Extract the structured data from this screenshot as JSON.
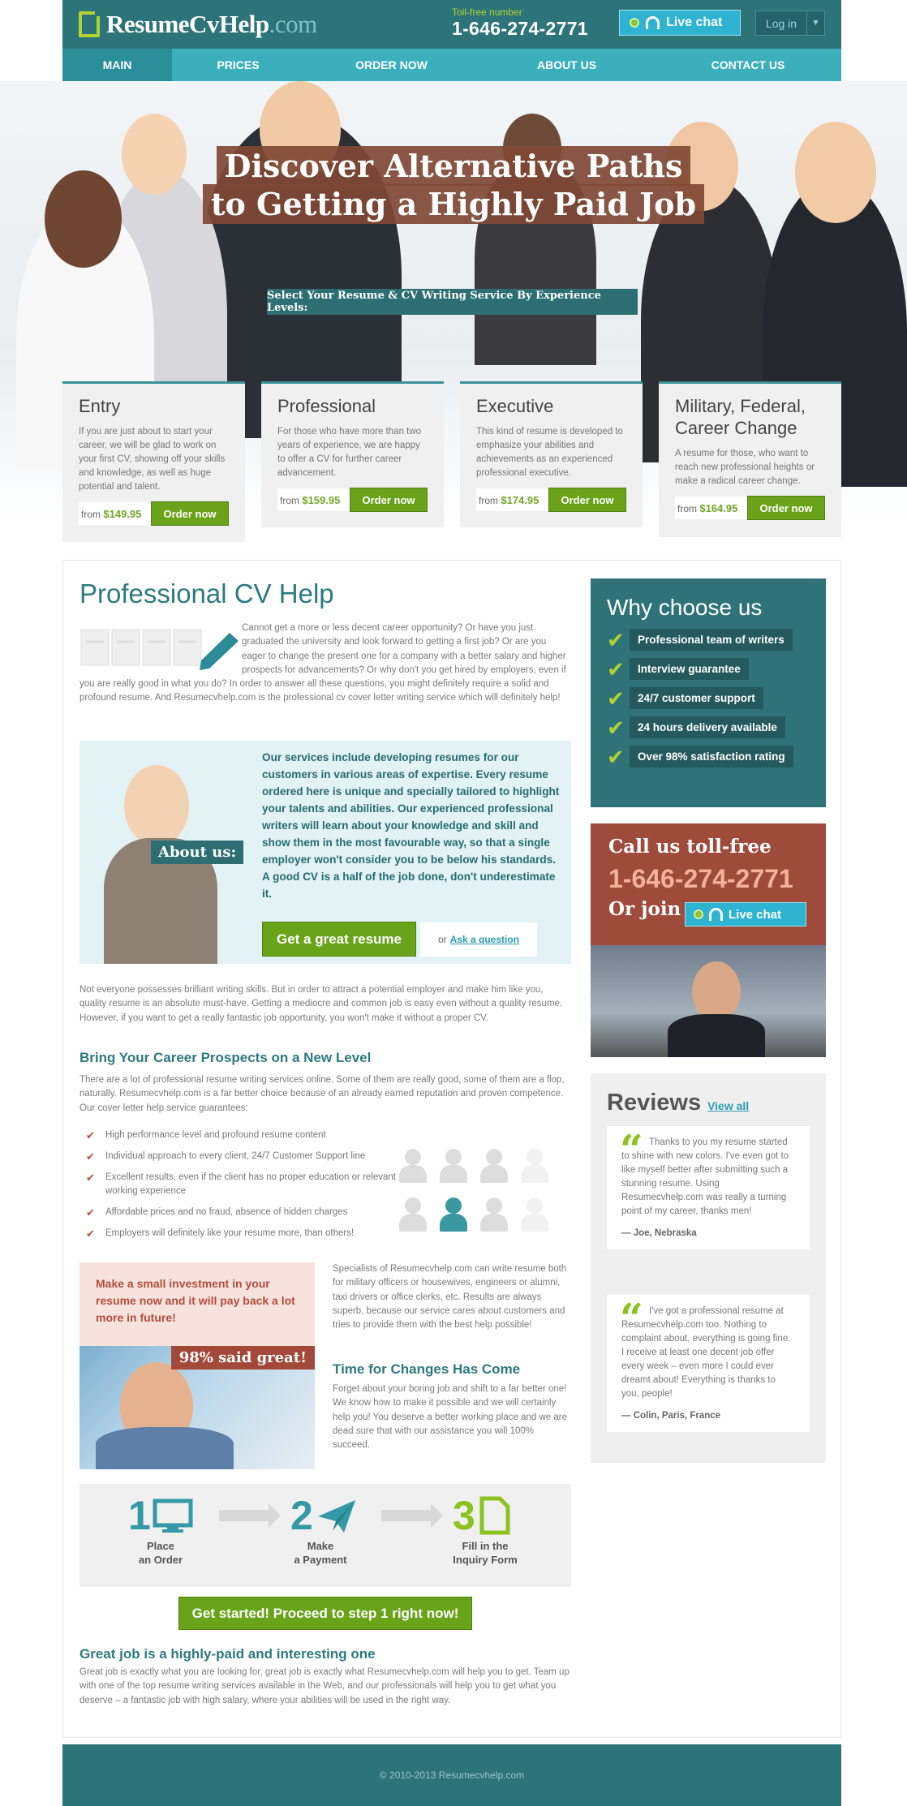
{
  "header": {
    "logo_main": "ResumeCvHelp",
    "logo_tld": ".com",
    "toll_label": "Toll-free number",
    "phone": "1-646-274-2771",
    "live_chat": "Live chat",
    "login": "Log in"
  },
  "nav": [
    {
      "label": "MAIN",
      "active": true
    },
    {
      "label": "PRICES"
    },
    {
      "label": "ORDER NOW"
    },
    {
      "label": "ABOUT US"
    },
    {
      "label": "CONTACT US"
    }
  ],
  "hero": {
    "title_line1": "Discover Alternative Paths",
    "title_line2": "to Getting a Highly Paid Job",
    "subtitle": "Select Your Resume & CV Writing Service By Experience Levels:"
  },
  "cards": [
    {
      "title": "Entry",
      "text": "If you are just about to start your career, we will be glad to work on your first CV, showing off your skills and knowledge, as well as huge potential and talent.",
      "from": "from",
      "price": "$149.95",
      "button": "Order now"
    },
    {
      "title": "Professional",
      "text": "For those who have more than two years of experience, we are happy to offer a CV for further career advancement.",
      "from": "from",
      "price": "$159.95",
      "button": "Order now"
    },
    {
      "title": "Executive",
      "text": "This kind of resume is developed to emphasize your abilities and achievements as an experienced professional executive.",
      "from": "from",
      "price": "$174.95",
      "button": "Order now"
    },
    {
      "title": "Military, Federal, Career Change",
      "text": "A resume for those, who want to reach new professional heights or make a radical career change.",
      "from": "from",
      "price": "$164.95",
      "button": "Order now"
    }
  ],
  "main": {
    "title": "Professional CV Help",
    "intro": "Cannot get a more or less decent career opportunity? Or have you just graduated the university and look forward to getting a first job? Or are you eager to change the present one for a company with a better salary and higher prospects for advancements? Or why don't you get hired by employers, even if you are really good in what you do? In order to answer all these questions, you might definitely require a solid and profound resume. And Resumecvhelp.com is the professional cv cover letter writing service which will definitely help!",
    "about_tag": "About us:",
    "about_text": "Our services include developing resumes for our customers in various areas of expertise. Every resume ordered here is unique and specially tailored to highlight your talents and abilities. Our experienced professional writers will learn about your knowledge and skill and show them in the most favourable way, so that a single employer won't consider you to be below his standards. A good CV is a half of the job done, don't underestimate it.",
    "get_resume": "Get a great resume",
    "or": "or",
    "ask": "Ask a question",
    "para2": "Not everyone possesses brilliant writing skills. But in order to attract a potential employer and make him like you, quality resume is an absolute must-have. Getting a mediocre and common job is easy even without a quality resume. However, if you want to get a really fantastic job opportunity, you won't make it without a proper CV.",
    "h_prospects": "Bring Your Career Prospects on a New Level",
    "para3": "There are a lot of professional resume writing services online. Some of them are really good, some of them are a flop, naturally. Resumecvhelp.com is a far better choice because of an already earned reputation and proven competence. Our cover letter help service guarantees:",
    "guarantees": [
      "High performance level and profound resume content",
      "Individual approach to every client, 24/7 Customer Support line",
      "Excellent results, even if the client has no proper education or relevant working experience",
      "Affordable prices and no fraud, absence of hidden charges",
      "Employers will definitely like your resume more, than others!"
    ],
    "invest": "Make a small investment in your resume now and it will pay back a lot more in future!",
    "said_great": "98% said great!",
    "specialists": "Specialists of Resumecvhelp.com can write resume both for military officers or housewives, engineers or alumni, taxi drivers or office clerks, etc. Results are always superb, because our service cares about customers and tries to provide them with the best help possible!",
    "h_changes": "Time for Changes Has Come",
    "changes": "Forget about your boring job and shift to a far better one! We know how to make it possible and we will certainly help you! You deserve a better working place and we are dead sure that with our assistance you will 100% succeed.",
    "steps": [
      {
        "num": "1",
        "label1": "Place",
        "label2": "an Order"
      },
      {
        "num": "2",
        "label1": "Make",
        "label2": "a Payment"
      },
      {
        "num": "3",
        "label1": "Fill in the",
        "label2": "Inquiry Form"
      }
    ],
    "get_started": "Get started! Proceed to step 1 right now!",
    "h_great": "Great job is a highly-paid and interesting one",
    "great": "Great job is exactly what you are looking for, great job is exactly what Resumecvhelp.com will help you to get. Team up with one of the top resume writing services available in the Web, and our professionals will help you to get what you deserve – a fantastic job with high salary, where your abilities will be used in the right way."
  },
  "why": {
    "title": "Why choose us",
    "items": [
      "Professional team of writers",
      "Interview guarantee",
      "24/7 customer support",
      "24 hours delivery available",
      "Over 98% satisfaction rating"
    ]
  },
  "call": {
    "line1": "Call us toll-free",
    "phone": "1-646-274-2771",
    "line3": "Or join",
    "live_chat": "Live chat"
  },
  "reviews": {
    "title": "Reviews",
    "view_all": "View all",
    "items": [
      {
        "text": "Thanks to you my resume started to shine with new colors. I've even got to like myself better after submitting such a stunning resume. Using Resumecvhelp.com was really a turning point of my career, thanks men!",
        "author": "— Joe, Nebraska"
      },
      {
        "text": "I've got a professional resume at Resumecvhelp.com too. Nothing to complaint about, everything is going fine. I receive at least one decent job offer every week – even more I could ever dreamt about! Everything is thanks to you, people!",
        "author": "— Colin, Paris, France"
      }
    ]
  },
  "footer": {
    "copyright": "© 2010-2013 Resumecvhelp.com"
  },
  "colors": {
    "teal": "#2d7479",
    "nav": "#3bb0bc",
    "green": "#6aa319",
    "rust": "#9e4b3c",
    "lime": "#b2d234"
  }
}
